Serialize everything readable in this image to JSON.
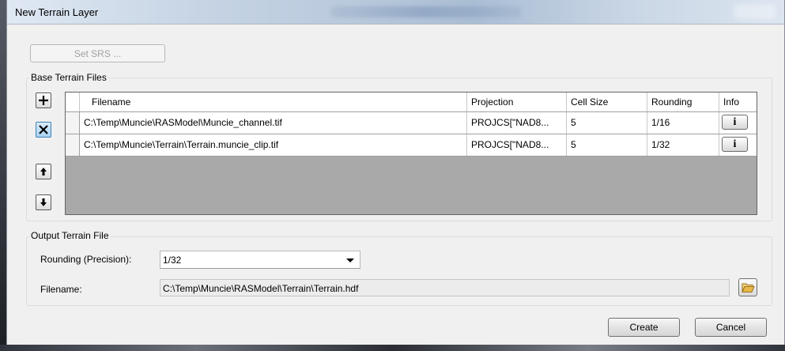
{
  "window": {
    "title": "New Terrain Layer"
  },
  "toolbar": {
    "set_srs_label": "Set SRS ..."
  },
  "base_terrain": {
    "group_title": "Base Terrain Files",
    "buttons": {
      "add": "+",
      "remove": "✕",
      "move_up": "↑",
      "move_down": "↓"
    },
    "columns": [
      "Filename",
      "Projection",
      "Cell Size",
      "Rounding",
      "Info"
    ],
    "rows": [
      {
        "filename": "C:\\Temp\\Muncie\\RASModel\\Muncie_channel.tif",
        "projection": "PROJCS[\"NAD8...",
        "cell_size": "5",
        "rounding": "1/16",
        "info": "i"
      },
      {
        "filename": "C:\\Temp\\Muncie\\Terrain\\Terrain.muncie_clip.tif",
        "projection": "PROJCS[\"NAD8...",
        "cell_size": "5",
        "rounding": "1/32",
        "info": "i"
      }
    ]
  },
  "output": {
    "group_title": "Output Terrain File",
    "rounding_label": "Rounding (Precision):",
    "rounding_value": "1/32",
    "filename_label": "Filename:",
    "filename_value": "C:\\Temp\\Muncie\\RASModel\\Terrain\\Terrain.hdf"
  },
  "footer": {
    "create_label": "Create",
    "cancel_label": "Cancel"
  },
  "icons": {
    "folder": "folder-open-icon",
    "dropdown": "chevron-down-icon"
  },
  "colors": {
    "grid_empty": "#a9a9a9",
    "remove_button": "#a8d3f3",
    "folder": "#e8b84a"
  }
}
